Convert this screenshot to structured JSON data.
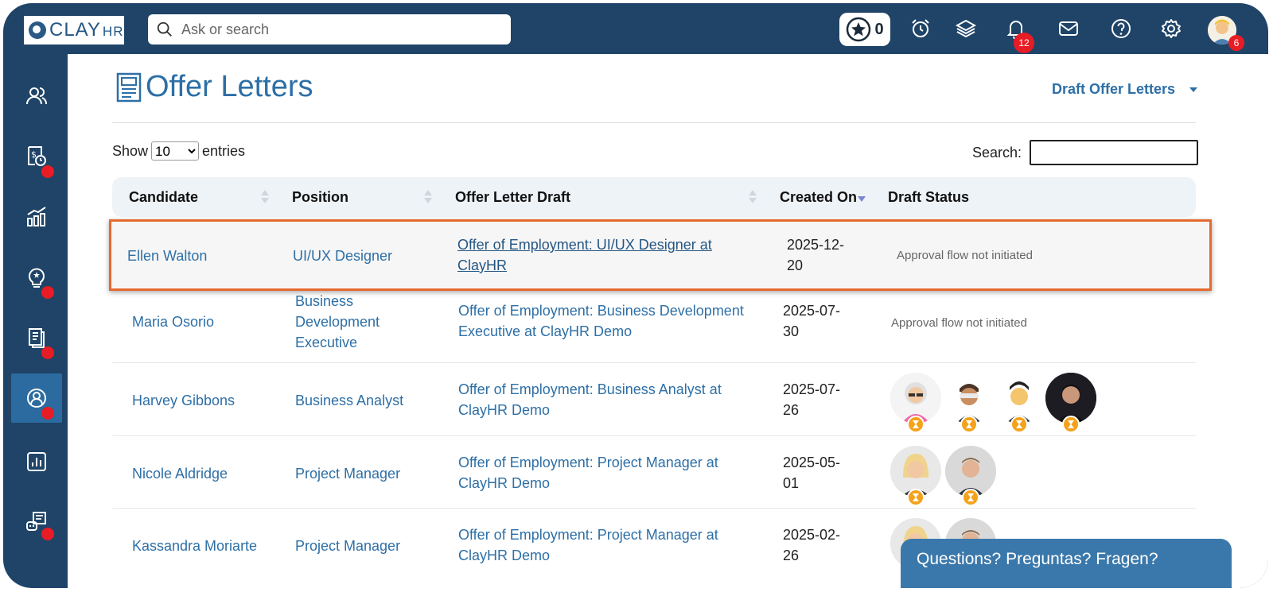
{
  "brand": {
    "name": "CLAY",
    "suffix": "HR"
  },
  "search": {
    "placeholder": "Ask or search"
  },
  "topbar": {
    "star_count": "0",
    "notification_count": "12",
    "profile_count": "6",
    "icons": [
      "star-icon",
      "alarm-clock-icon",
      "layers-icon",
      "bell-icon",
      "mail-icon",
      "help-icon",
      "gear-icon",
      "avatar"
    ]
  },
  "sidebar": {
    "items": [
      {
        "name": "people-icon",
        "active": false,
        "dot": false
      },
      {
        "name": "payroll-icon",
        "active": false,
        "dot": true
      },
      {
        "name": "analytics-icon",
        "active": false,
        "dot": false
      },
      {
        "name": "ideas-icon",
        "active": false,
        "dot": true
      },
      {
        "name": "documents-icon",
        "active": false,
        "dot": true
      },
      {
        "name": "recruiting-icon",
        "active": true,
        "dot": true
      },
      {
        "name": "reports-icon",
        "active": false,
        "dot": false
      },
      {
        "name": "bot-icon",
        "active": false,
        "dot": true
      }
    ]
  },
  "page": {
    "title": "Offer Letters",
    "filter_label": "Draft Offer Letters"
  },
  "table": {
    "show_label": "Show",
    "entries_value": "10",
    "entries_label": "entries",
    "search_label": "Search:",
    "columns": [
      "Candidate",
      "Position",
      "Offer Letter Draft",
      "Created On",
      "Draft Status"
    ],
    "rows": [
      {
        "candidate": "Ellen Walton",
        "position": "UI/UX Designer",
        "draft": "Offer of Employment: UI/UX Designer at ClayHR",
        "created_on": "2025-12-20",
        "status": "Approval flow not initiated"
      },
      {
        "candidate": "Maria Osorio",
        "position": "Business Development Executive",
        "draft": "Offer of Employment: Business Development Executive at ClayHR Demo",
        "created_on": "2025-07-30",
        "status": "Approval flow not initiated"
      },
      {
        "candidate": "Harvey Gibbons",
        "position": "Business Analyst",
        "draft": "Offer of Employment: Business Analyst at ClayHR Demo",
        "created_on": "2025-07-26",
        "status": ""
      },
      {
        "candidate": "Nicole Aldridge",
        "position": "Project Manager",
        "draft": "Offer of Employment: Project Manager at ClayHR Demo",
        "created_on": "2025-05-01",
        "status": ""
      },
      {
        "candidate": "Kassandra Moriarte",
        "position": "Project Manager",
        "draft": "Offer of Employment: Project Manager at ClayHR Demo",
        "created_on": "2025-02-26",
        "status": ""
      }
    ]
  },
  "chat": {
    "label": "Questions? Preguntas? Fragen?"
  },
  "colors": {
    "navy": "#1f4468",
    "link": "#2d6fa6",
    "highlight": "#e6692e",
    "badge": "#e81c24",
    "pending": "#f5a21b"
  }
}
